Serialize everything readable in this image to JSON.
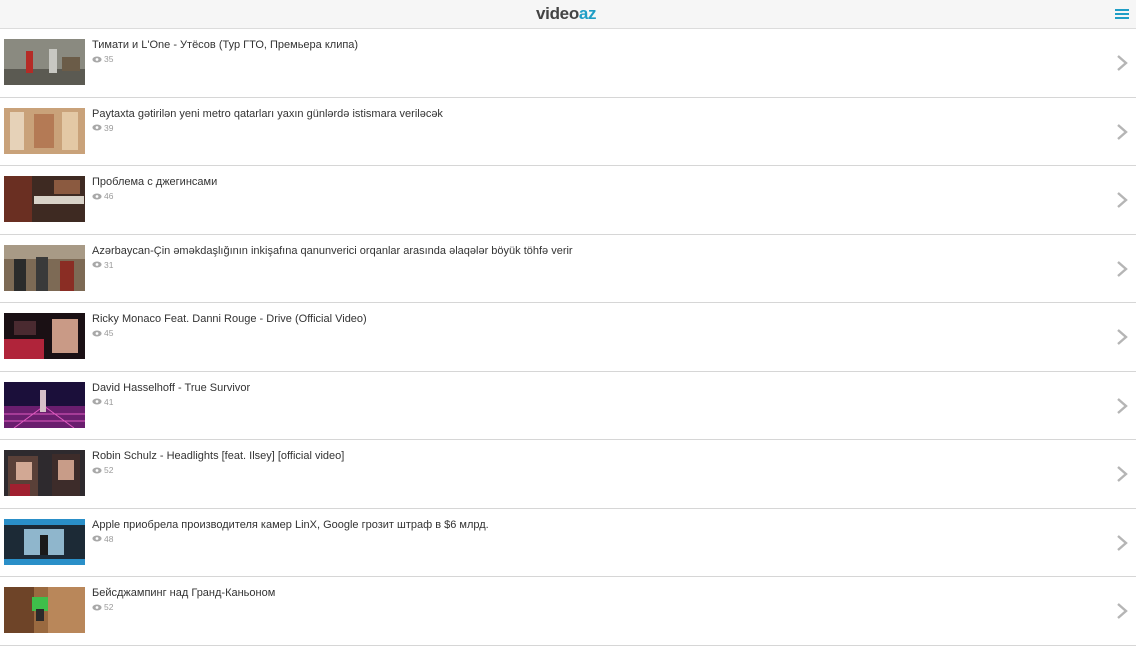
{
  "header": {
    "logo_main": "video",
    "logo_accent": "az",
    "menu_icon": "hamburger-menu-icon"
  },
  "colors": {
    "accent": "#1f9ec6",
    "text": "#333333",
    "muted": "#9a9a9a",
    "divider": "#d6d6d6",
    "header_bg": "#f6f6f6"
  },
  "videos": [
    {
      "title": "Тимати и L'One - Утёсов (Тур ГТО, Премьера клипа)",
      "views": "35"
    },
    {
      "title": "Paytaxta gətirilən yeni metro qatarları yaxın günlərdə istismara veriləcək",
      "views": "39"
    },
    {
      "title": "Проблема с джегинсами",
      "views": "46"
    },
    {
      "title": "Azərbaycan-Çin əməkdaşlığının inkişafına qanunverici orqanlar arasında əlaqələr böyük töhfə verir",
      "views": "31"
    },
    {
      "title": "Ricky Monaco Feat. Danni Rouge - Drive (Official Video)",
      "views": "45"
    },
    {
      "title": "David Hasselhoff - True Survivor",
      "views": "41"
    },
    {
      "title": "Robin Schulz - Headlights [feat. Ilsey] [official video]",
      "views": "52"
    },
    {
      "title": "Apple приобрела производителя камер LinX, Google грозит штраф в $6 млрд.",
      "views": "48"
    },
    {
      "title": "Бейсджампинг над Гранд-Каньоном",
      "views": "52"
    }
  ]
}
